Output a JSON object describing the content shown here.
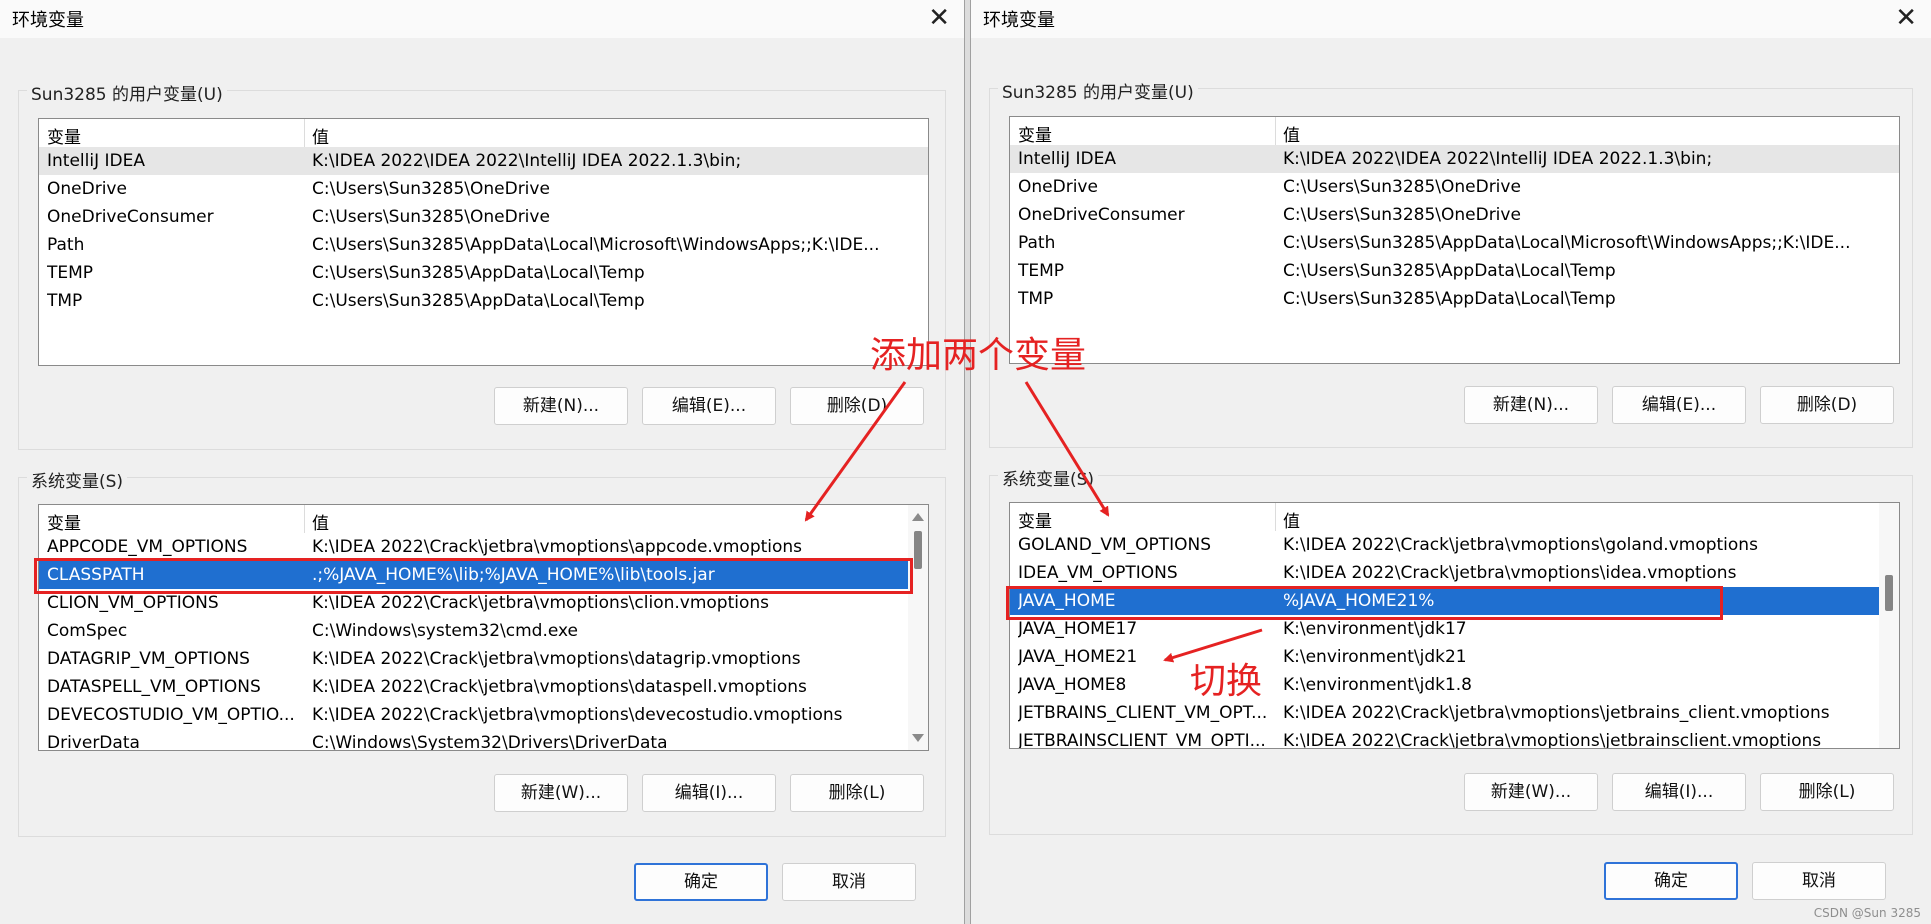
{
  "left": {
    "title": "环境变量",
    "user_group_label": "Sun3285 的用户变量(U)",
    "system_group_label": "系统变量(S)",
    "columns": [
      "变量",
      "值"
    ],
    "user_rows": [
      [
        "IntelliJ IDEA",
        "K:\\IDEA 2022\\IDEA 2022\\IntelliJ IDEA 2022.1.3\\bin;"
      ],
      [
        "OneDrive",
        "C:\\Users\\Sun3285\\OneDrive"
      ],
      [
        "OneDriveConsumer",
        "C:\\Users\\Sun3285\\OneDrive"
      ],
      [
        "Path",
        "C:\\Users\\Sun3285\\AppData\\Local\\Microsoft\\WindowsApps;;K:\\IDE..."
      ],
      [
        "TEMP",
        "C:\\Users\\Sun3285\\AppData\\Local\\Temp"
      ],
      [
        "TMP",
        "C:\\Users\\Sun3285\\AppData\\Local\\Temp"
      ]
    ],
    "system_rows": [
      [
        "APPCODE_VM_OPTIONS",
        "K:\\IDEA 2022\\Crack\\jetbra\\vmoptions\\appcode.vmoptions"
      ],
      [
        "CLASSPATH",
        ".;%JAVA_HOME%\\lib;%JAVA_HOME%\\lib\\tools.jar"
      ],
      [
        "CLION_VM_OPTIONS",
        "K:\\IDEA 2022\\Crack\\jetbra\\vmoptions\\clion.vmoptions"
      ],
      [
        "ComSpec",
        "C:\\Windows\\system32\\cmd.exe"
      ],
      [
        "DATAGRIP_VM_OPTIONS",
        "K:\\IDEA 2022\\Crack\\jetbra\\vmoptions\\datagrip.vmoptions"
      ],
      [
        "DATASPELL_VM_OPTIONS",
        "K:\\IDEA 2022\\Crack\\jetbra\\vmoptions\\dataspell.vmoptions"
      ],
      [
        "DEVECOSTUDIO_VM_OPTIO...",
        "K:\\IDEA 2022\\Crack\\jetbra\\vmoptions\\devecostudio.vmoptions"
      ],
      [
        "DriverData",
        "C:\\Windows\\System32\\Drivers\\DriverData"
      ]
    ],
    "user_buttons": [
      "新建(N)...",
      "编辑(E)...",
      "删除(D)"
    ],
    "system_buttons": [
      "新建(W)...",
      "编辑(I)...",
      "删除(L)"
    ],
    "ok": "确定",
    "cancel": "取消"
  },
  "right": {
    "title": "环境变量",
    "user_group_label": "Sun3285 的用户变量(U)",
    "system_group_label": "系统变量(S)",
    "columns": [
      "变量",
      "值"
    ],
    "user_rows": [
      [
        "IntelliJ IDEA",
        "K:\\IDEA 2022\\IDEA 2022\\IntelliJ IDEA 2022.1.3\\bin;"
      ],
      [
        "OneDrive",
        "C:\\Users\\Sun3285\\OneDrive"
      ],
      [
        "OneDriveConsumer",
        "C:\\Users\\Sun3285\\OneDrive"
      ],
      [
        "Path",
        "C:\\Users\\Sun3285\\AppData\\Local\\Microsoft\\WindowsApps;;K:\\IDE..."
      ],
      [
        "TEMP",
        "C:\\Users\\Sun3285\\AppData\\Local\\Temp"
      ],
      [
        "TMP",
        "C:\\Users\\Sun3285\\AppData\\Local\\Temp"
      ]
    ],
    "system_rows": [
      [
        "GOLAND_VM_OPTIONS",
        "K:\\IDEA 2022\\Crack\\jetbra\\vmoptions\\goland.vmoptions"
      ],
      [
        "IDEA_VM_OPTIONS",
        "K:\\IDEA 2022\\Crack\\jetbra\\vmoptions\\idea.vmoptions"
      ],
      [
        "JAVA_HOME",
        "%JAVA_HOME21%"
      ],
      [
        "JAVA_HOME17",
        "K:\\environment\\jdk17"
      ],
      [
        "JAVA_HOME21",
        "K:\\environment\\jdk21"
      ],
      [
        "JAVA_HOME8",
        "K:\\environment\\jdk1.8"
      ],
      [
        "JETBRAINS_CLIENT_VM_OPT...",
        "K:\\IDEA 2022\\Crack\\jetbra\\vmoptions\\jetbrains_client.vmoptions"
      ],
      [
        "JETBRAINSCLIENT_VM_OPTI...",
        "K:\\IDEA 2022\\Crack\\jetbra\\vmoptions\\jetbrainsclient.vmoptions"
      ]
    ],
    "user_buttons": [
      "新建(N)...",
      "编辑(E)...",
      "删除(D)"
    ],
    "system_buttons": [
      "新建(W)...",
      "编辑(I)...",
      "删除(L)"
    ],
    "ok": "确定",
    "cancel": "取消"
  },
  "annotations": {
    "add_two": "添加两个变量",
    "switch": "切换",
    "color": "#e52222"
  },
  "watermark": "CSDN @Sun 3285",
  "colors": {
    "selection": "#1f6fd0",
    "primary_border": "#2f73d8"
  }
}
